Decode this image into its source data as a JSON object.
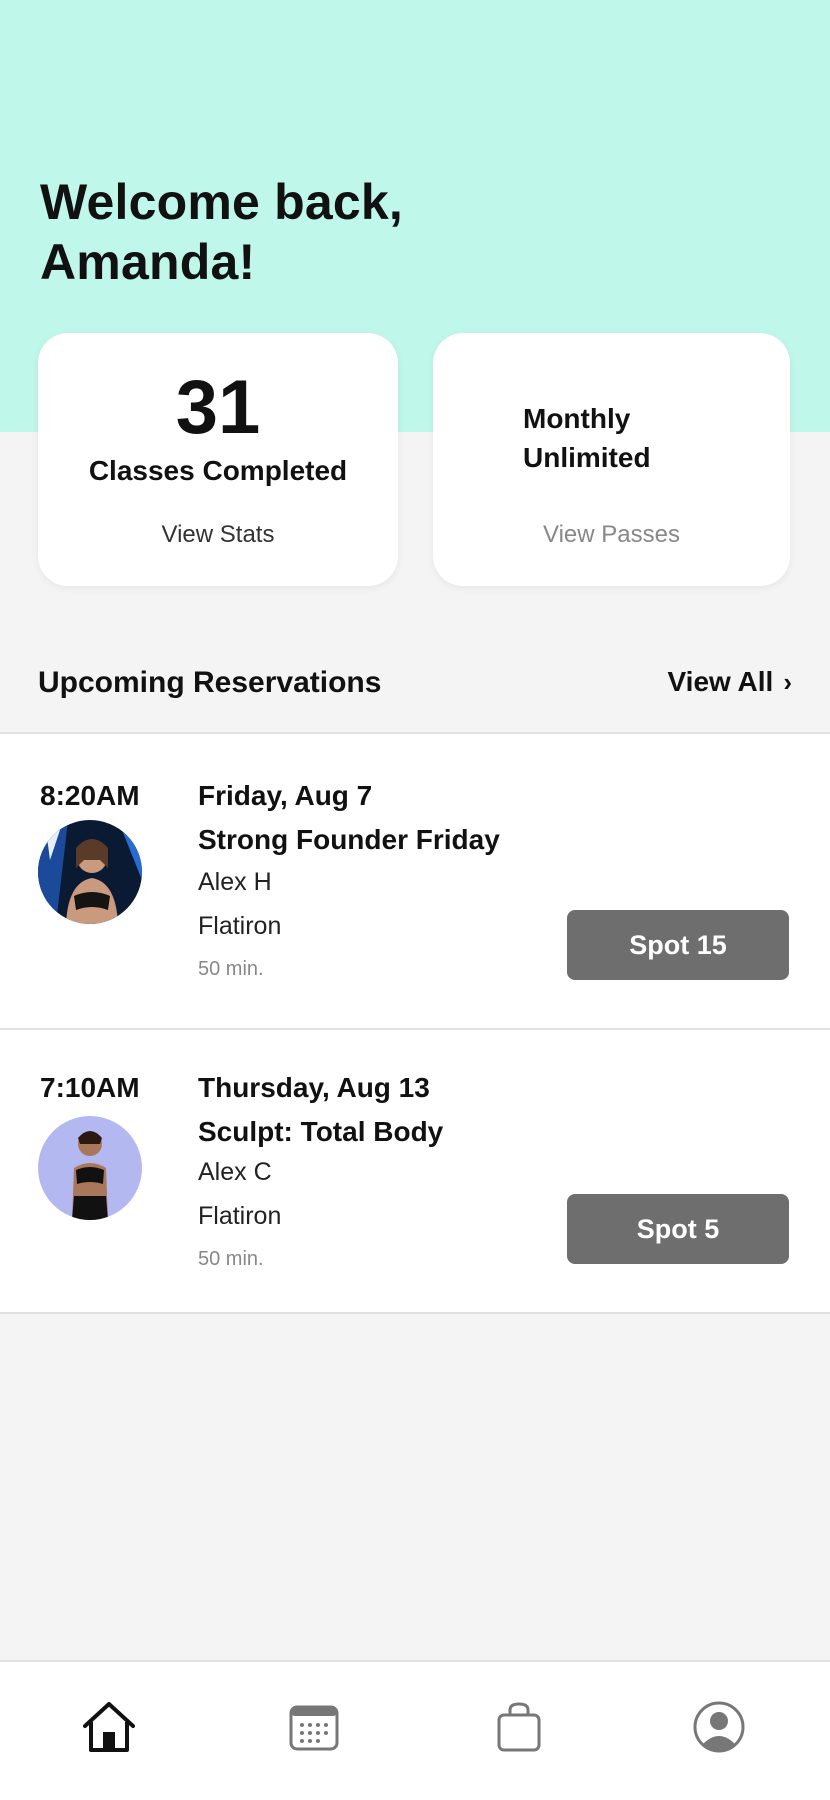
{
  "header": {
    "greeting": "Welcome back, Amanda!",
    "background_color": "#bff7ea"
  },
  "stats_card": {
    "count": "31",
    "label": "Classes Completed",
    "link": "View Stats"
  },
  "pass_card": {
    "pass_name": "Monthly Unlimited",
    "link": "View Passes"
  },
  "reservations": {
    "title": "Upcoming Reservations",
    "view_all_label": "View All",
    "items": [
      {
        "time": "8:20AM",
        "date": "Friday, Aug 7",
        "class_name": "Strong Founder Friday",
        "instructor": "Alex H",
        "location": "Flatiron",
        "duration": "50 min.",
        "spot": "Spot 15",
        "avatar_icon": "instructor-photo"
      },
      {
        "time": "7:10AM",
        "date": "Thursday, Aug 13",
        "class_name": "Sculpt: Total Body",
        "instructor": "Alex C",
        "location": "Flatiron",
        "duration": "50 min.",
        "spot": "Spot 5",
        "avatar_icon": "instructor-photo"
      }
    ]
  },
  "tabbar": {
    "tabs": [
      {
        "icon": "home-icon",
        "active": true
      },
      {
        "icon": "calendar-icon",
        "active": false
      },
      {
        "icon": "shopping-bag-icon",
        "active": false
      },
      {
        "icon": "profile-icon",
        "active": false
      }
    ]
  },
  "colors": {
    "accent": "#bff7ea",
    "spot_button": "#6e6e6e"
  }
}
